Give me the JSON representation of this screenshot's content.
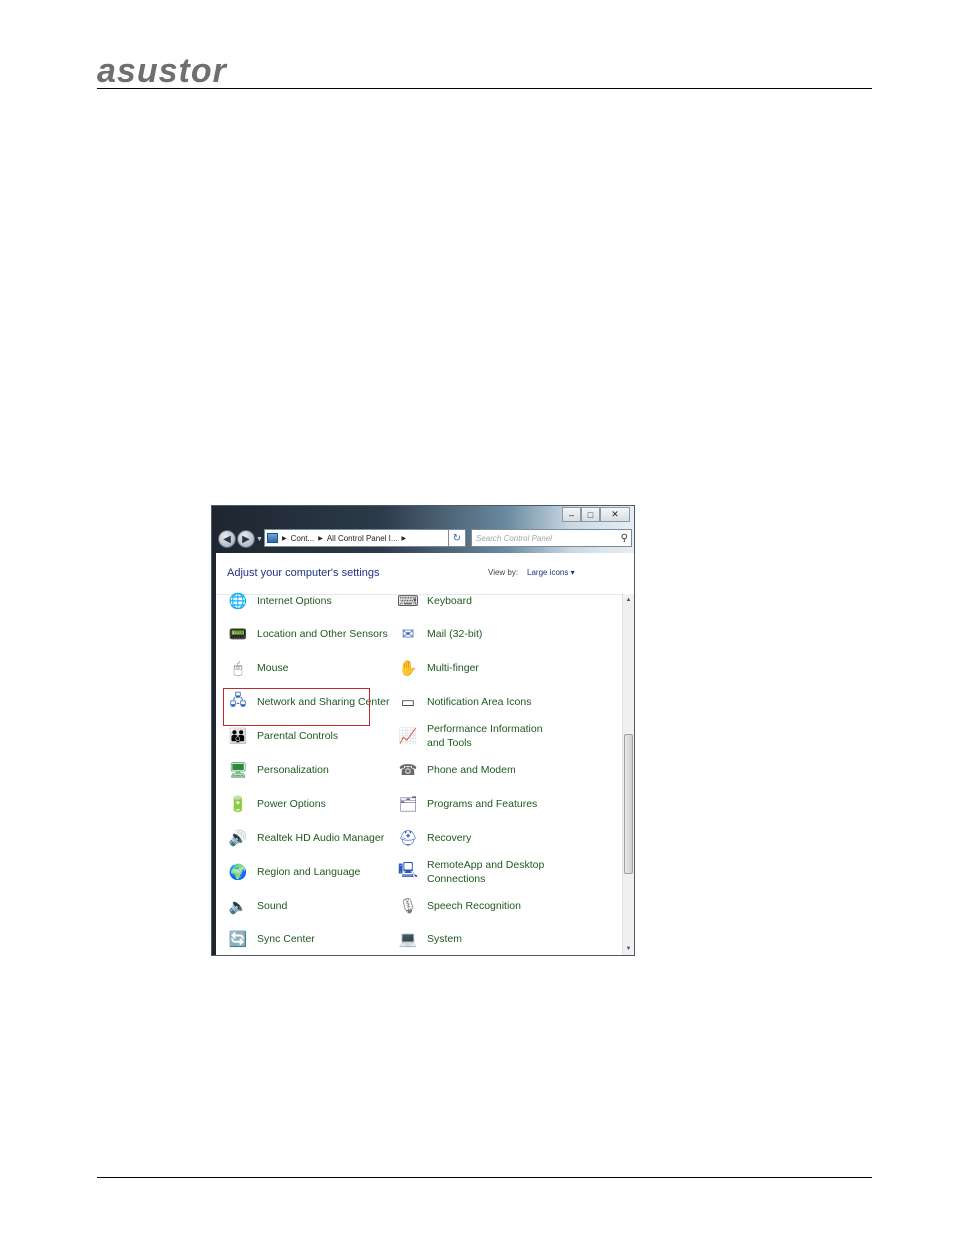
{
  "header": {
    "logo_text": "asustor"
  },
  "window": {
    "captions": {
      "minimize": "‒",
      "maximize": "□",
      "close": "✕"
    },
    "address": {
      "seg1": "Cont...",
      "seg2": "All Control Panel I..."
    },
    "search_placeholder": "Search Control Panel",
    "title": "Adjust your computer's settings",
    "view_by_label": "View by:",
    "view_by_value": "Large icons ▾"
  },
  "left_items": [
    {
      "label": "Internet Options",
      "icon": "globe-icon"
    },
    {
      "label": "Location and Other Sensors",
      "icon": "sensor-icon"
    },
    {
      "label": "Mouse",
      "icon": "mouse-icon"
    },
    {
      "label": "Network and Sharing Center",
      "icon": "network-icon"
    },
    {
      "label": "Parental Controls",
      "icon": "family-icon"
    },
    {
      "label": "Personalization",
      "icon": "monitor-icon"
    },
    {
      "label": "Power Options",
      "icon": "power-icon"
    },
    {
      "label": "Realtek HD Audio Manager",
      "icon": "audio-icon"
    },
    {
      "label": "Region and Language",
      "icon": "globe-clock-icon"
    },
    {
      "label": "Sound",
      "icon": "speaker-icon"
    },
    {
      "label": "Sync Center",
      "icon": "sync-icon"
    }
  ],
  "right_items": [
    {
      "label": "Keyboard",
      "icon": "keyboard-icon"
    },
    {
      "label": "Mail (32-bit)",
      "icon": "mail-icon"
    },
    {
      "label": "Multi-finger",
      "icon": "multi-finger-icon"
    },
    {
      "label": "Notification Area Icons",
      "icon": "taskbar-icon"
    },
    {
      "label": "Performance Information and Tools",
      "icon": "performance-icon"
    },
    {
      "label": "Phone and Modem",
      "icon": "phone-icon"
    },
    {
      "label": "Programs and Features",
      "icon": "programs-icon"
    },
    {
      "label": "Recovery",
      "icon": "recovery-icon"
    },
    {
      "label": "RemoteApp and Desktop Connections",
      "icon": "remote-icon"
    },
    {
      "label": "Speech Recognition",
      "icon": "microphone-icon"
    },
    {
      "label": "System",
      "icon": "system-icon"
    }
  ]
}
